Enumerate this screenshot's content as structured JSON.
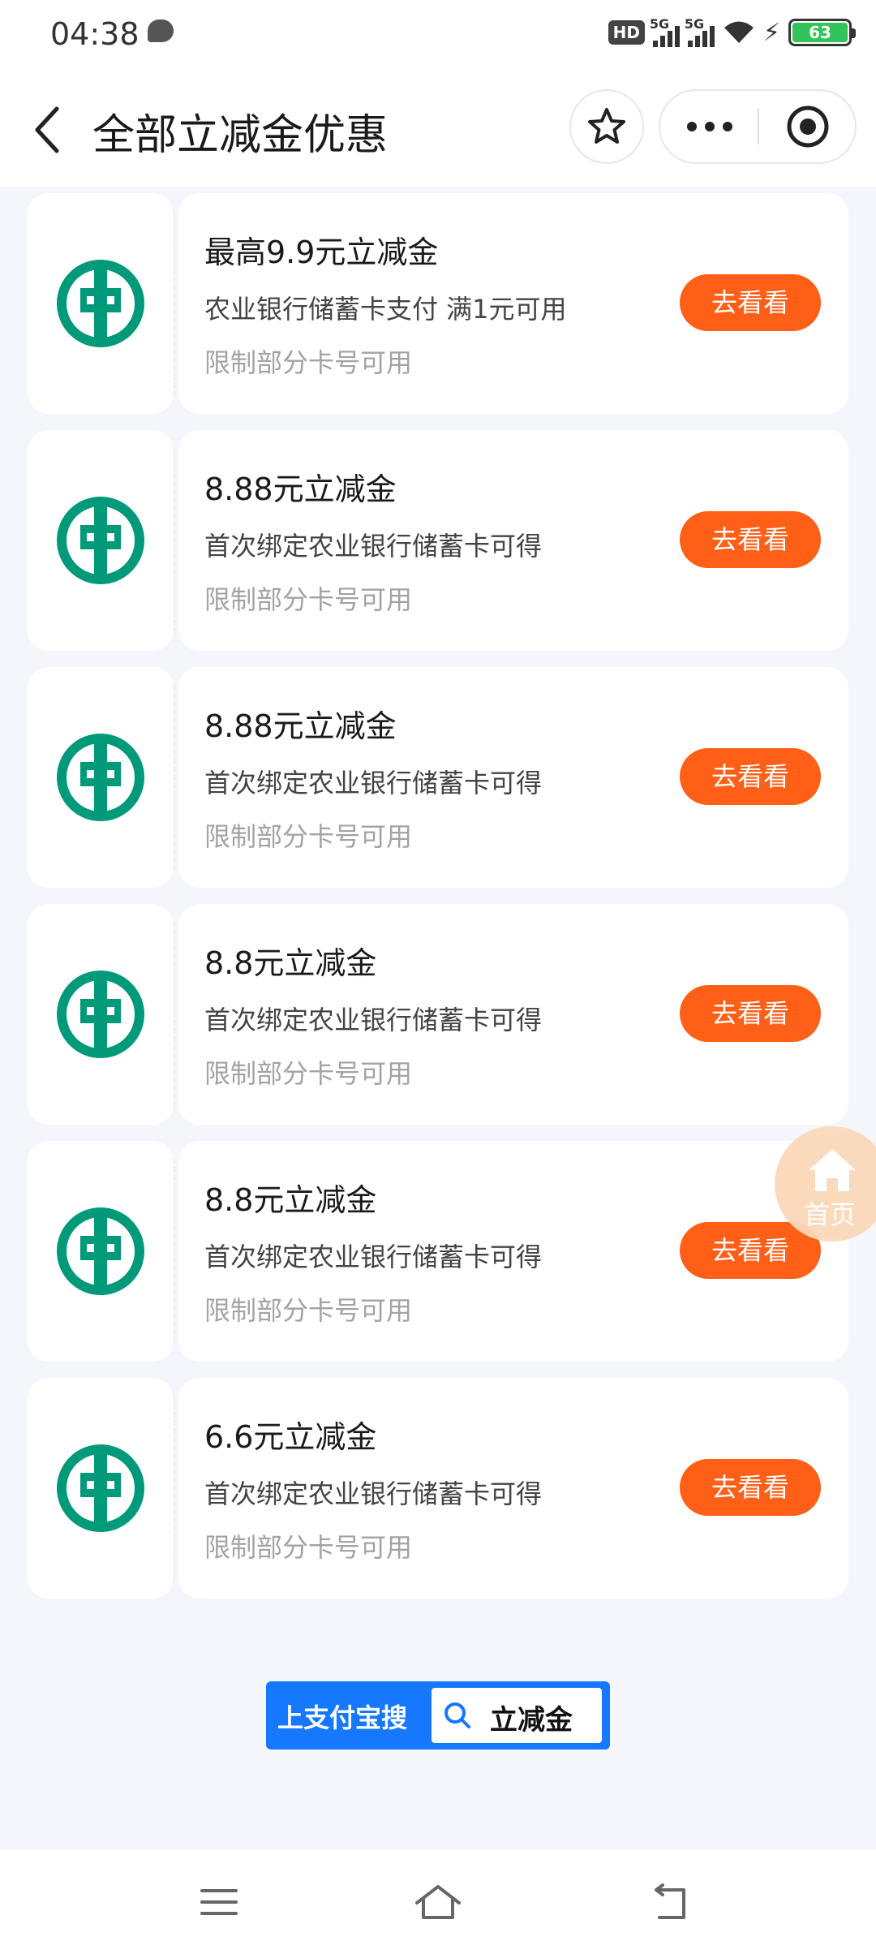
{
  "status_bar": {
    "time": "04:38",
    "hd_label": "HD",
    "sim1_label": "5G",
    "sim2_label": "5G",
    "battery_level": "63"
  },
  "header": {
    "title": "全部立减金优惠"
  },
  "coupons": [
    {
      "title": "最高9.9元立减金",
      "desc": "农业银行储蓄卡支付 满1元可用",
      "limit": "限制部分卡号可用",
      "button": "去看看"
    },
    {
      "title": "8.88元立减金",
      "desc": "首次绑定农业银行储蓄卡可得",
      "limit": "限制部分卡号可用",
      "button": "去看看"
    },
    {
      "title": "8.88元立减金",
      "desc": "首次绑定农业银行储蓄卡可得",
      "limit": "限制部分卡号可用",
      "button": "去看看"
    },
    {
      "title": "8.8元立减金",
      "desc": "首次绑定农业银行储蓄卡可得",
      "limit": "限制部分卡号可用",
      "button": "去看看"
    },
    {
      "title": "8.8元立减金",
      "desc": "首次绑定农业银行储蓄卡可得",
      "limit": "限制部分卡号可用",
      "button": "去看看"
    },
    {
      "title": "6.6元立减金",
      "desc": "首次绑定农业银行储蓄卡可得",
      "limit": "限制部分卡号可用",
      "button": "去看看"
    }
  ],
  "float_home": {
    "label": "首页"
  },
  "search_banner": {
    "prefix": "上支付宝搜",
    "keyword": "立减金"
  },
  "icons": {
    "bank_logo": "abc-bank-logo-icon",
    "back": "chevron-left-icon",
    "favorite": "star-icon",
    "more": "more-dots-icon",
    "close": "target-close-icon",
    "home": "home-icon",
    "search": "search-icon"
  },
  "colors": {
    "accent_button": "#ff5f17",
    "bank_green": "#009a7a",
    "search_blue": "#1677ff",
    "float_home_bg": "#fbd9b9"
  }
}
